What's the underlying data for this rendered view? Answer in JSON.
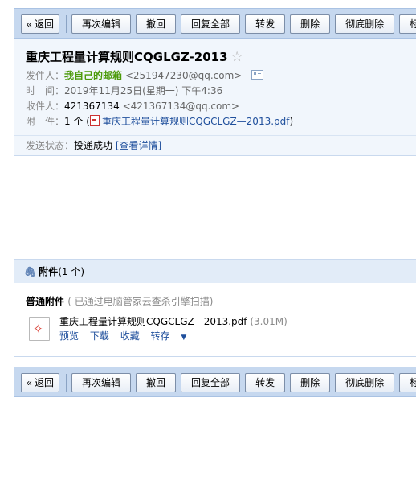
{
  "toolbar": {
    "back": "« 返回",
    "reedit": "再次编辑",
    "recall": "撤回",
    "reply_all": "回复全部",
    "forward": "转发",
    "delete": "删除",
    "delete_forever": "彻底删除",
    "mark": "标记为"
  },
  "mail": {
    "subject": "重庆工程量计算规则CQGLGZ-2013",
    "star": "☆",
    "sender_label": "发件人：",
    "sender_name": "我自己的邮箱",
    "sender_addr": "<251947230@qq.com>",
    "time_label": "时　间：",
    "time_value": "2019年11月25日(星期一) 下午4:36",
    "recipient_label": "收件人：",
    "recipient_name": "421367134",
    "recipient_addr": "<421367134@qq.com>",
    "attach_label": "附　件：",
    "attach_count": "1 个 (",
    "attach_file": "重庆工程量计算规则CQGCLGZ—2013.pdf",
    "attach_close": ")",
    "status_label": "发送状态：",
    "status_value": "投递成功",
    "status_link": "[查看详情]"
  },
  "attachments": {
    "title": "附件",
    "count": "(1 个)",
    "section": "普通附件",
    "scan_note": "( 已通过电脑管家云查杀引擎扫描)",
    "file_name": "重庆工程量计算规则CQGCLGZ—2013.pdf",
    "file_size": "(3.01M)",
    "actions": {
      "preview": "预览",
      "download": "下载",
      "favorite": "收藏",
      "save_to": "转存"
    }
  }
}
